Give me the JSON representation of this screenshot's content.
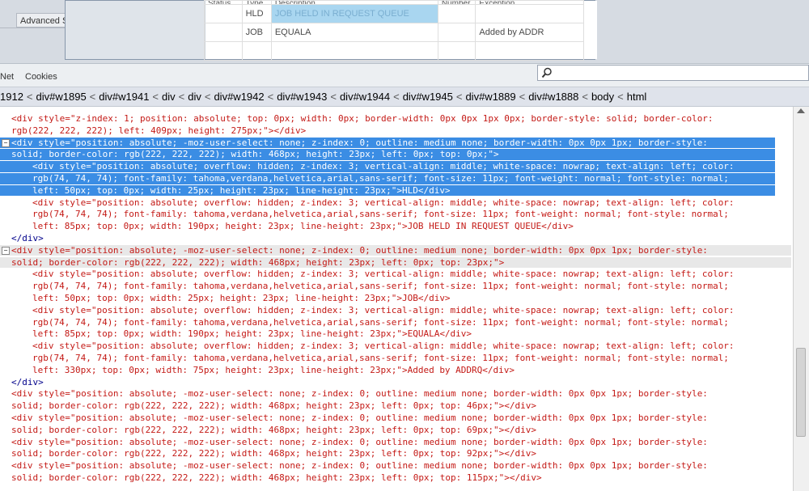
{
  "top_app": {
    "advanced_button": "Advanced S",
    "grid_headers": [
      "Status",
      "Type",
      "Description",
      "Number",
      "Exception"
    ],
    "rows": [
      {
        "type": "HLD",
        "description": "JOB HELD IN REQUEST QUEUE",
        "exception": ""
      },
      {
        "type": "JOB",
        "description": "EQUALA",
        "exception": "Added by ADDR"
      }
    ]
  },
  "toolbar": {
    "tabs": [
      "Net",
      "Cookies"
    ],
    "search_placeholder": ""
  },
  "breadcrumb": [
    "1912",
    "div#w1895",
    "div#w1941",
    "div",
    "div",
    "div#w1942",
    "div#w1943",
    "div#w1944",
    "div#w1945",
    "div#w1889",
    "div#w1888",
    "body",
    "html"
  ],
  "html_lines": [
    {
      "indent": 1,
      "text": "<div style=\"z-index: 1; position: absolute; top: 0px; width: 0px; border-width: 0px 0px 1px 0px; border-style: solid; border-color:",
      "cls": "red"
    },
    {
      "indent": 1,
      "text": "rgb(222, 222, 222); left: 409px; height: 275px;\"></div>",
      "cls": "red"
    },
    {
      "indent": 1,
      "text": "<div style=\"position: absolute; -moz-user-select: none; z-index: 0; outline: medium none; border-width: 0px 0px 1px; border-style:",
      "cls": "sel"
    },
    {
      "indent": 1,
      "text": "solid; border-color: rgb(222, 222, 222); width: 468px; height: 23px; left: 0px; top: 0px;\">",
      "cls": "sel"
    },
    {
      "indent": 2,
      "text": "<div style=\"position: absolute; overflow: hidden; z-index: 3; vertical-align: middle; white-space: nowrap; text-align: left; color:",
      "cls": "sel"
    },
    {
      "indent": 2,
      "text": "rgb(74, 74, 74); font-family: tahoma,verdana,helvetica,arial,sans-serif; font-size: 11px; font-weight: normal; font-style: normal;",
      "cls": "sel"
    },
    {
      "indent": 2,
      "text": "left: 50px; top: 0px; width: 25px; height: 23px; line-height: 23px;\">HLD</div>",
      "cls": "sel"
    },
    {
      "indent": 2,
      "text": "<div style=\"position: absolute; overflow: hidden; z-index: 3; vertical-align: middle; white-space: nowrap; text-align: left; color:",
      "cls": "red"
    },
    {
      "indent": 2,
      "text": "rgb(74, 74, 74); font-family: tahoma,verdana,helvetica,arial,sans-serif; font-size: 11px; font-weight: normal; font-style: normal;",
      "cls": "red"
    },
    {
      "indent": 2,
      "text": "left: 85px; top: 0px; width: 190px; height: 23px; line-height: 23px;\">JOB HELD IN REQUEST QUEUE</div>",
      "cls": "red"
    },
    {
      "indent": 1,
      "text": "</div>",
      "cls": "tag"
    },
    {
      "indent": 1,
      "text": "<div style=\"position: absolute; -moz-user-select: none; z-index: 0; outline: medium none; border-width: 0px 0px 1px; border-style:",
      "cls": "hover"
    },
    {
      "indent": 1,
      "text": "solid; border-color: rgb(222, 222, 222); width: 468px; height: 23px; left: 0px; top: 23px;\">",
      "cls": "hover"
    },
    {
      "indent": 2,
      "text": "<div style=\"position: absolute; overflow: hidden; z-index: 3; vertical-align: middle; white-space: nowrap; text-align: left; color:",
      "cls": "red"
    },
    {
      "indent": 2,
      "text": "rgb(74, 74, 74); font-family: tahoma,verdana,helvetica,arial,sans-serif; font-size: 11px; font-weight: normal; font-style: normal;",
      "cls": "red"
    },
    {
      "indent": 2,
      "text": "left: 50px; top: 0px; width: 25px; height: 23px; line-height: 23px;\">JOB</div>",
      "cls": "red"
    },
    {
      "indent": 2,
      "text": "<div style=\"position: absolute; overflow: hidden; z-index: 3; vertical-align: middle; white-space: nowrap; text-align: left; color:",
      "cls": "red"
    },
    {
      "indent": 2,
      "text": "rgb(74, 74, 74); font-family: tahoma,verdana,helvetica,arial,sans-serif; font-size: 11px; font-weight: normal; font-style: normal;",
      "cls": "red"
    },
    {
      "indent": 2,
      "text": "left: 85px; top: 0px; width: 190px; height: 23px; line-height: 23px;\">EQUALA</div>",
      "cls": "red"
    },
    {
      "indent": 2,
      "text": "<div style=\"position: absolute; overflow: hidden; z-index: 3; vertical-align: middle; white-space: nowrap; text-align: left; color:",
      "cls": "red"
    },
    {
      "indent": 2,
      "text": "rgb(74, 74, 74); font-family: tahoma,verdana,helvetica,arial,sans-serif; font-size: 11px; font-weight: normal; font-style: normal;",
      "cls": "red"
    },
    {
      "indent": 2,
      "text": "left: 330px; top: 0px; width: 75px; height: 23px; line-height: 23px;\">Added by ADDRQ</div>",
      "cls": "red"
    },
    {
      "indent": 1,
      "text": "</div>",
      "cls": "tag"
    },
    {
      "indent": 1,
      "text": "<div style=\"position: absolute; -moz-user-select: none; z-index: 0; outline: medium none; border-width: 0px 0px 1px; border-style:",
      "cls": "red"
    },
    {
      "indent": 1,
      "text": "solid; border-color: rgb(222, 222, 222); width: 468px; height: 23px; left: 0px; top: 46px;\"></div>",
      "cls": "red"
    },
    {
      "indent": 1,
      "text": "<div style=\"position: absolute; -moz-user-select: none; z-index: 0; outline: medium none; border-width: 0px 0px 1px; border-style:",
      "cls": "red"
    },
    {
      "indent": 1,
      "text": "solid; border-color: rgb(222, 222, 222); width: 468px; height: 23px; left: 0px; top: 69px;\"></div>",
      "cls": "red"
    },
    {
      "indent": 1,
      "text": "<div style=\"position: absolute; -moz-user-select: none; z-index: 0; outline: medium none; border-width: 0px 0px 1px; border-style:",
      "cls": "red"
    },
    {
      "indent": 1,
      "text": "solid; border-color: rgb(222, 222, 222); width: 468px; height: 23px; left: 0px; top: 92px;\"></div>",
      "cls": "red"
    },
    {
      "indent": 1,
      "text": "<div style=\"position: absolute; -moz-user-select: none; z-index: 0; outline: medium none; border-width: 0px 0px 1px; border-style:",
      "cls": "red"
    },
    {
      "indent": 1,
      "text": "solid; border-color: rgb(222, 222, 222); width: 468px; height: 23px; left: 0px; top: 115px;\"></div>",
      "cls": "red"
    }
  ]
}
